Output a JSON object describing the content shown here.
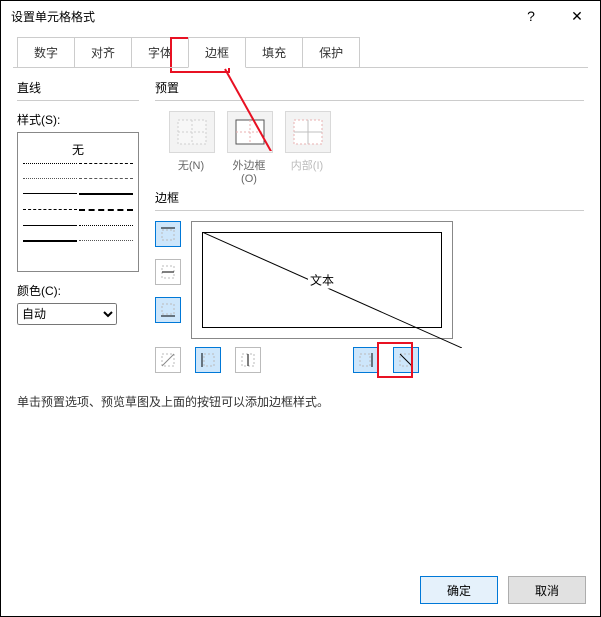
{
  "window": {
    "title": "设置单元格格式"
  },
  "titlebar_buttons": {
    "help": "?",
    "close": "✕"
  },
  "tabs": [
    "数字",
    "对齐",
    "字体",
    "边框",
    "填充",
    "保护"
  ],
  "active_tab_index": 3,
  "left": {
    "section_label": "直线",
    "style_label": "样式(S):",
    "none_label": "无",
    "color_label": "颜色(C):",
    "color_value": "自动"
  },
  "right": {
    "preset_label": "预置",
    "presets": [
      {
        "name": "none",
        "label": "无(N)"
      },
      {
        "name": "outline",
        "label": "外边框(O)"
      },
      {
        "name": "inside",
        "label": "内部(I)"
      }
    ],
    "border_label": "边框",
    "preview_caption": "文本"
  },
  "hint": "单击预置选项、预览草图及上面的按钮可以添加边框样式。",
  "buttons": {
    "ok": "确定",
    "cancel": "取消"
  },
  "colors": {
    "accent": "#e81123",
    "selection": "#0078d7"
  }
}
